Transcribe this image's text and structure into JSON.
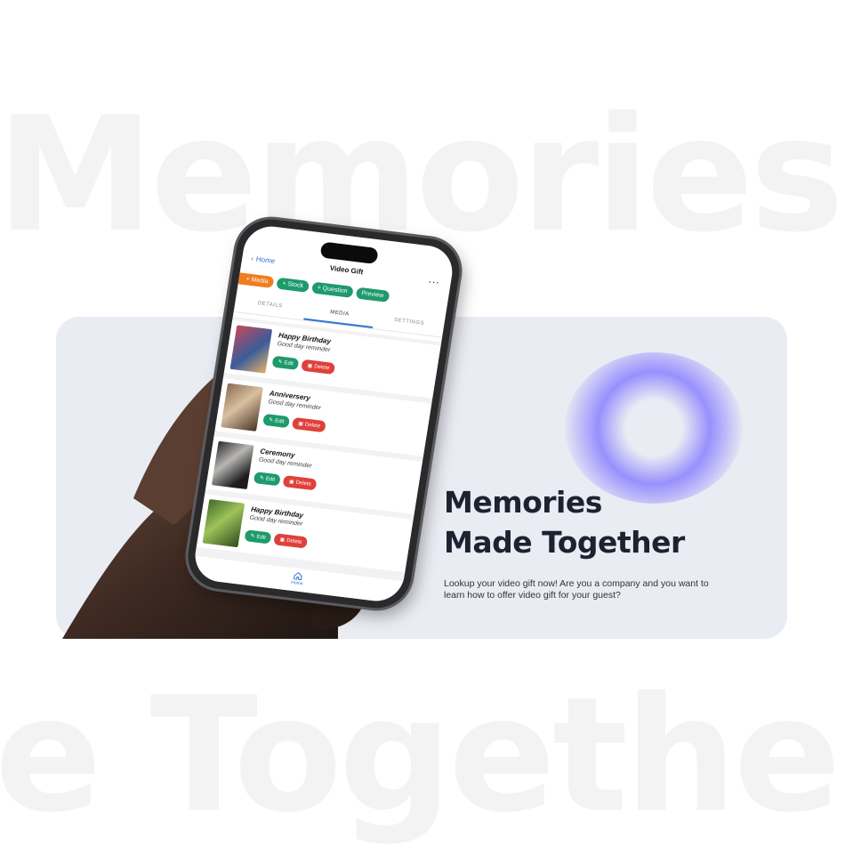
{
  "background": {
    "word_top": "Memories",
    "word_bottom": "e Togethe"
  },
  "hero": {
    "title_line1": "Memories",
    "title_line2": "Made Together",
    "description": "Lookup your video gift now! Are you a company and you want to learn how to offer video gift for your guest?",
    "accent_color": "#8980ff"
  },
  "app": {
    "nav": {
      "back_label": "Home",
      "title": "Video Gift",
      "more_label": "..."
    },
    "chips": [
      {
        "label": "+ Media",
        "color": "#f07d1e"
      },
      {
        "label": "+ Stock",
        "color": "#1e9a6d"
      },
      {
        "label": "+ Question",
        "color": "#1e9a6d"
      },
      {
        "label": "Preview",
        "color": "#1e9a6d"
      }
    ],
    "tabs": [
      {
        "label": "DETAILS"
      },
      {
        "label": "MEDIA"
      },
      {
        "label": "SETTINGS"
      }
    ],
    "items": [
      {
        "name": "Happy Birthday",
        "desc": "Good day reminder",
        "edit_label": "Edit",
        "delete_label": "Delete"
      },
      {
        "name": "Anniversery",
        "desc": "Good day reminder",
        "edit_label": "Edit",
        "delete_label": "Delete"
      },
      {
        "name": "Ceremony",
        "desc": "Good day reminder",
        "edit_label": "Edit",
        "delete_label": "Delete"
      },
      {
        "name": "Happy Birthday",
        "desc": "Good day reminder",
        "edit_label": "Edit",
        "delete_label": "Delete"
      }
    ],
    "footer_label": "Home",
    "colors": {
      "edit": "#1e9a6d",
      "delete": "#e0403a",
      "link": "#2f73d6"
    }
  }
}
